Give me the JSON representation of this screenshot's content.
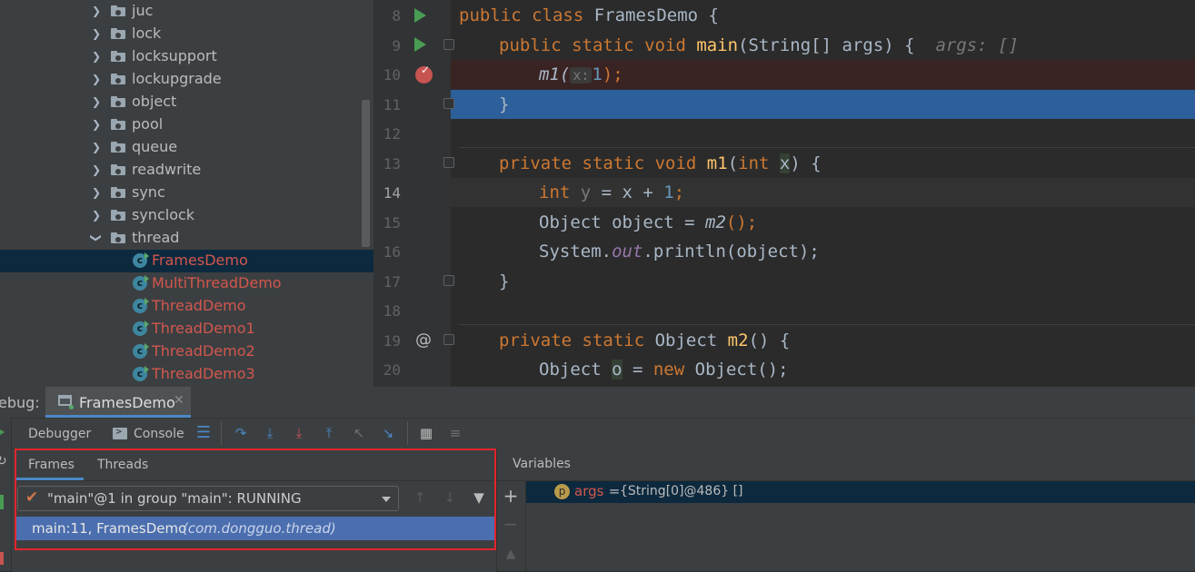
{
  "project_tree": {
    "packages": [
      {
        "label": "juc",
        "expanded": false
      },
      {
        "label": "lock",
        "expanded": false
      },
      {
        "label": "locksupport",
        "expanded": false
      },
      {
        "label": "lockupgrade",
        "expanded": false
      },
      {
        "label": "object",
        "expanded": false
      },
      {
        "label": "pool",
        "expanded": false
      },
      {
        "label": "queue",
        "expanded": false
      },
      {
        "label": "readwrite",
        "expanded": false
      },
      {
        "label": "sync",
        "expanded": false
      },
      {
        "label": "synclock",
        "expanded": false
      },
      {
        "label": "thread",
        "expanded": true
      }
    ],
    "classes": [
      "FramesDemo",
      "MultiThreadDemo",
      "ThreadDemo",
      "ThreadDemo1",
      "ThreadDemo2",
      "ThreadDemo3"
    ],
    "selected_class": "FramesDemo"
  },
  "editor": {
    "line_numbers": [
      "8",
      "9",
      "10",
      "11",
      "12",
      "13",
      "14",
      "15",
      "16",
      "17",
      "18",
      "19",
      "20"
    ],
    "current_line": "14",
    "code": {
      "l8": {
        "kw": "public class ",
        "name": "FramesDemo {"
      },
      "l9": {
        "kw": "public static void ",
        "fn": "main",
        "rest": "(String[] args) {",
        "hint": "args: []"
      },
      "l10": {
        "call": "m1(",
        "inlay": "x:",
        "num": "1",
        "end": ");"
      },
      "l11": {
        "text": "}"
      },
      "l13": {
        "kw": "private static ",
        "kw2": "void ",
        "fn": "m1",
        "open": "(",
        "type": "int ",
        "param": "x",
        "close": ") {"
      },
      "l14": {
        "type": "int ",
        "var": "y",
        "mid": " = x + ",
        "num": "1",
        "end": ";"
      },
      "l15": {
        "pre": "Object object = ",
        "call": "m2",
        "end": "();"
      },
      "l16": {
        "pre": "System.",
        "field": "out",
        "post": ".println(object);"
      },
      "l17": {
        "text": "}"
      },
      "l19": {
        "kw": "private static ",
        "type": "Object ",
        "fn": "m2",
        "rest": "() {"
      },
      "l20": {
        "pre": "Object ",
        "var": "o",
        "mid": " = ",
        "kw": "new ",
        "post": "Object();"
      }
    }
  },
  "debug": {
    "label": "ebug:",
    "session_tab": "FramesDemo",
    "toolbar": {
      "debugger": "Debugger",
      "console": "Console"
    },
    "frames_tab": "Frames",
    "threads_tab": "Threads",
    "thread_select": "\"main\"@1 in group \"main\": RUNNING",
    "frame": {
      "location": "main:11, FramesDemo",
      "package": "(com.dongguo.thread)"
    },
    "variables_title": "Variables",
    "variable": {
      "name": "args",
      "eq": " = ",
      "value": "{String[0]@486} []"
    },
    "colors": {
      "selection": "#4b6eaf",
      "highlight_box": "#e3242b",
      "breakpoint": "#c75450"
    }
  }
}
